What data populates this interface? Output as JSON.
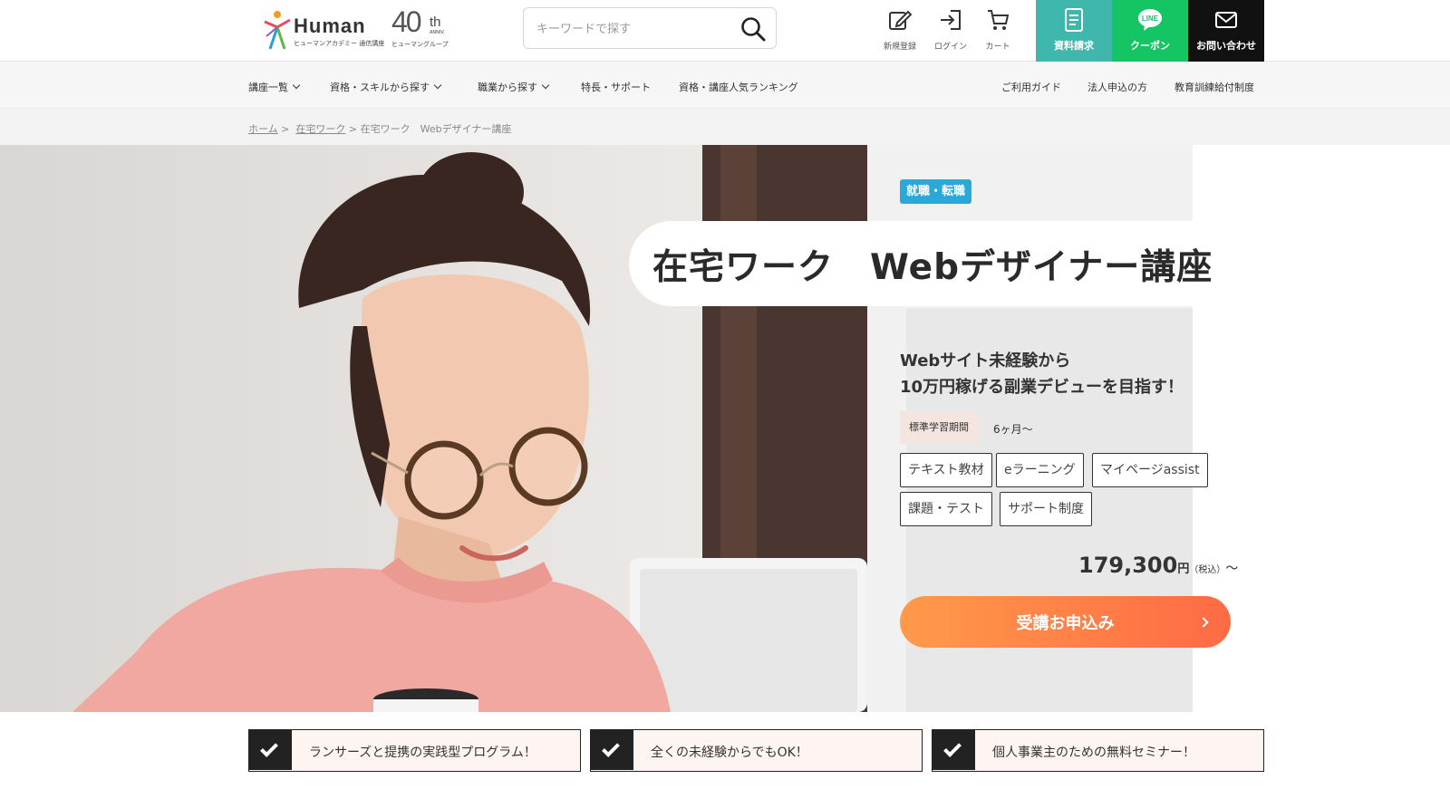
{
  "header": {
    "logo_name": "Human",
    "logo_subtitle": "ヒューマンアカデミー 通信講座",
    "anniv_number": "40",
    "anniv_suffix": "th",
    "anniv_small": "ANNIV.",
    "anniv_group": "ヒューマングループ",
    "search_placeholder": "キーワードで探す",
    "icons": [
      {
        "label": "新規登録",
        "icon": "pencil-icon"
      },
      {
        "label": "ログイン",
        "icon": "login-icon"
      },
      {
        "label": "カート",
        "icon": "cart-icon"
      }
    ],
    "buttons": {
      "documents": "資料請求",
      "coupon_logo": "LINE",
      "coupon": "クーポン",
      "contact": "お問い合わせ"
    },
    "colors": {
      "documents": "#3fb7ad",
      "coupon": "#15c463",
      "contact": "#111111"
    }
  },
  "nav": {
    "left": [
      "講座一覧",
      "資格・スキルから探す",
      "職業から探す",
      "特長・サポート",
      "資格・講座人気ランキング"
    ],
    "right": [
      "ご利用ガイド",
      "法人申込の方",
      "教育訓練給付制度"
    ]
  },
  "breadcrumb": {
    "home": "ホーム",
    "sep1": ">",
    "category": "在宅ワーク",
    "current": "> 在宅ワーク　Webデザイナー講座"
  },
  "hero": {
    "category_badge": "就職・転職",
    "title": "在宅ワーク　Webデザイナー講座",
    "lead": "Webサイト未経験から\n10万円稼げる副業デビューを目指す！",
    "period_label": "標準学習期間",
    "period_value": "6ヶ月〜",
    "features": [
      "テキスト教材",
      "eラーニング",
      "マイページassist",
      "課題・テスト",
      "サポート制度"
    ],
    "price": "179,300",
    "price_unit": "円",
    "price_tax": "（税込）",
    "price_suffix": "〜",
    "apply_label": "受講お申込み",
    "colors": {
      "badge": "#2aa8d8",
      "apply_from": "#ff9a4a",
      "apply_to": "#ff6a45"
    }
  },
  "points": [
    "ランサーズと提携の実践型プログラム！",
    "全くの未経験からでもOK！",
    "個人事業主のための無料セミナー！"
  ]
}
